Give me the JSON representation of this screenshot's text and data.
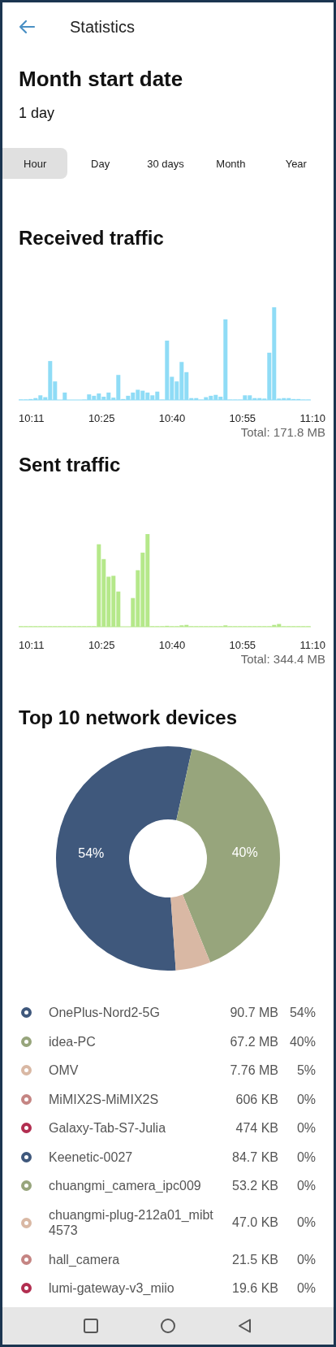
{
  "header": {
    "title": "Statistics"
  },
  "month_start": {
    "title": "Month start date",
    "value": "1 day"
  },
  "tabs": [
    {
      "label": "Hour",
      "selected": true
    },
    {
      "label": "Day",
      "selected": false
    },
    {
      "label": "30 days",
      "selected": false
    },
    {
      "label": "Month",
      "selected": false
    },
    {
      "label": "Year",
      "selected": false
    }
  ],
  "charts": [
    {
      "kind": "received",
      "title": "Received traffic",
      "x_labels": [
        "10:11",
        "10:25",
        "10:40",
        "10:55",
        "11:10"
      ],
      "total": "Total: 171.8 MB"
    },
    {
      "kind": "sent",
      "title": "Sent traffic",
      "x_labels": [
        "10:11",
        "10:25",
        "10:40",
        "10:55",
        "11:10"
      ],
      "total": "Total: 344.4 MB"
    }
  ],
  "top_devices": {
    "title": "Top 10 network devices",
    "chart_data": {
      "type": "donut",
      "values": [
        54,
        40,
        5,
        0,
        0,
        0,
        0,
        0,
        0,
        0
      ],
      "value_labels": [
        "54%",
        "40%",
        null,
        null,
        null,
        null,
        null,
        null,
        null,
        null
      ]
    },
    "items": [
      {
        "name": "OnePlus-Nord2-5G",
        "size": "90.7 MB",
        "percent": "54%",
        "color": "#3f587c"
      },
      {
        "name": "idea-PC",
        "size": "67.2 MB",
        "percent": "40%",
        "color": "#97a57c"
      },
      {
        "name": "OMV",
        "size": "7.76 MB",
        "percent": "5%",
        "color": "#d9b8a4"
      },
      {
        "name": "MiMIX2S-MiMIX2S",
        "size": "606 KB",
        "percent": "0%",
        "color": "#c58583"
      },
      {
        "name": "Galaxy-Tab-S7-Julia",
        "size": "474 KB",
        "percent": "0%",
        "color": "#b22e50"
      },
      {
        "name": "Keenetic-0027",
        "size": "84.7 KB",
        "percent": "0%",
        "color": "#3f587c"
      },
      {
        "name": "chuangmi_camera_ipc009",
        "size": "53.2 KB",
        "percent": "0%",
        "color": "#97a57c"
      },
      {
        "name": "chuangmi-plug-212a01_mibt4573",
        "size": "47.0 KB",
        "percent": "0%",
        "color": "#d9b8a4"
      },
      {
        "name": "hall_camera",
        "size": "21.5 KB",
        "percent": "0%",
        "color": "#c58583"
      },
      {
        "name": "lumi-gateway-v3_miio",
        "size": "19.6 KB",
        "percent": "0%",
        "color": "#b22e50"
      }
    ]
  }
}
